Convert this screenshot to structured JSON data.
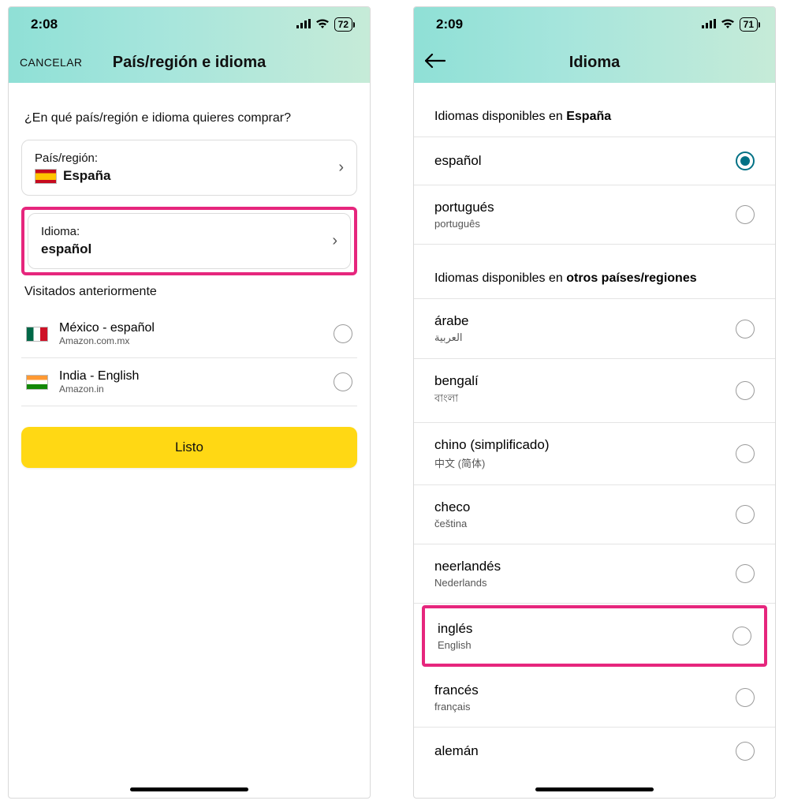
{
  "left": {
    "status": {
      "time": "2:08",
      "battery": "72"
    },
    "header": {
      "cancel": "CANCELAR",
      "title": "País/región e idioma"
    },
    "prompt": "¿En qué país/región e idioma quieres comprar?",
    "country_card": {
      "label": "País/región:",
      "value": "España"
    },
    "language_card": {
      "label": "Idioma:",
      "value": "español"
    },
    "visited_header": "Visitados anteriormente",
    "visited": [
      {
        "name": "México - español",
        "sub": "Amazon.com.mx",
        "flag": "mx"
      },
      {
        "name": "India - English",
        "sub": "Amazon.in",
        "flag": "in"
      }
    ],
    "done": "Listo"
  },
  "right": {
    "status": {
      "time": "2:09",
      "battery": "71"
    },
    "header": {
      "title": "Idioma"
    },
    "section1_prefix": "Idiomas disponibles en ",
    "section1_bold": "España",
    "langs_es": [
      {
        "name": "español",
        "native": "",
        "selected": true
      },
      {
        "name": "portugués",
        "native": "português",
        "selected": false
      }
    ],
    "section2_prefix": "Idiomas disponibles en ",
    "section2_bold": "otros países/regiones",
    "langs_other": [
      {
        "name": "árabe",
        "native": "العربية"
      },
      {
        "name": "bengalí",
        "native": "বাংলা"
      },
      {
        "name": "chino (simplificado)",
        "native": "中文 (简体)"
      },
      {
        "name": "checo",
        "native": "čeština"
      },
      {
        "name": "neerlandés",
        "native": "Nederlands"
      },
      {
        "name": "inglés",
        "native": "English",
        "highlight": true
      },
      {
        "name": "francés",
        "native": "français"
      },
      {
        "name": "alemán",
        "native": ""
      }
    ]
  }
}
